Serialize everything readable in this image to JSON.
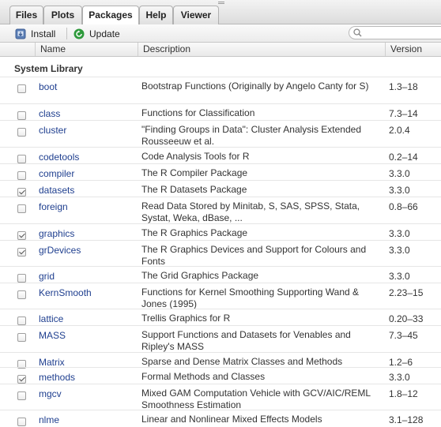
{
  "tabs": [
    {
      "label": "Files",
      "active": false
    },
    {
      "label": "Plots",
      "active": false
    },
    {
      "label": "Packages",
      "active": true
    },
    {
      "label": "Help",
      "active": false
    },
    {
      "label": "Viewer",
      "active": false
    }
  ],
  "toolbar": {
    "install_label": "Install",
    "update_label": "Update",
    "search_placeholder": ""
  },
  "table": {
    "columns": [
      "Name",
      "Description",
      "Version"
    ],
    "section_title": "System Library",
    "rows": [
      {
        "name": "boot",
        "description": "Bootstrap Functions (Originally by Angelo Canty for S)",
        "version": "1.3–18",
        "checked": false
      },
      {
        "name": "class",
        "description": "Functions for Classification",
        "version": "7.3–14",
        "checked": false
      },
      {
        "name": "cluster",
        "description": "\"Finding Groups in Data\": Cluster Analysis Extended Rousseeuw et al.",
        "version": "2.0.4",
        "checked": false
      },
      {
        "name": "codetools",
        "description": "Code Analysis Tools for R",
        "version": "0.2–14",
        "checked": false
      },
      {
        "name": "compiler",
        "description": "The R Compiler Package",
        "version": "3.3.0",
        "checked": false
      },
      {
        "name": "datasets",
        "description": "The R Datasets Package",
        "version": "3.3.0",
        "checked": true
      },
      {
        "name": "foreign",
        "description": "Read Data Stored by Minitab, S, SAS, SPSS, Stata, Systat, Weka, dBase, ...",
        "version": "0.8–66",
        "checked": false
      },
      {
        "name": "graphics",
        "description": "The R Graphics Package",
        "version": "3.3.0",
        "checked": true
      },
      {
        "name": "grDevices",
        "description": "The R Graphics Devices and Support for Colours and Fonts",
        "version": "3.3.0",
        "checked": true
      },
      {
        "name": "grid",
        "description": "The Grid Graphics Package",
        "version": "3.3.0",
        "checked": false
      },
      {
        "name": "KernSmooth",
        "description": "Functions for Kernel Smoothing Supporting Wand & Jones (1995)",
        "version": "2.23–15",
        "checked": false
      },
      {
        "name": "lattice",
        "description": "Trellis Graphics for R",
        "version": "0.20–33",
        "checked": false
      },
      {
        "name": "MASS",
        "description": "Support Functions and Datasets for Venables and Ripley's MASS",
        "version": "7.3–45",
        "checked": false
      },
      {
        "name": "Matrix",
        "description": "Sparse and Dense Matrix Classes and Methods",
        "version": "1.2–6",
        "checked": false
      },
      {
        "name": "methods",
        "description": "Formal Methods and Classes",
        "version": "3.3.0",
        "checked": true
      },
      {
        "name": "mgcv",
        "description": "Mixed GAM Computation Vehicle with GCV/AIC/REML Smoothness Estimation",
        "version": "1.8–12",
        "checked": false
      },
      {
        "name": "nlme",
        "description": "Linear and Nonlinear Mixed Effects Models",
        "version": "3.1–128",
        "checked": false
      }
    ]
  },
  "colors": {
    "package_link": "#1f3f8f",
    "update_green": "#2e9a3c",
    "install_blue": "#5b7fb6"
  }
}
